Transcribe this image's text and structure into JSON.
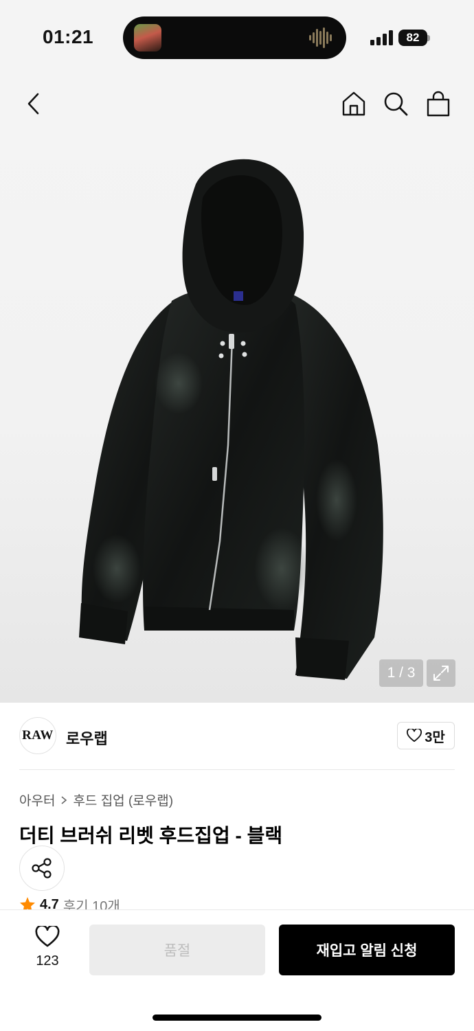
{
  "status_bar": {
    "time": "01:21",
    "battery": "82"
  },
  "header": {
    "back_icon": "chevron-left-icon",
    "home_icon": "home-icon",
    "search_icon": "search-icon",
    "cart_icon": "shopping-bag-icon"
  },
  "gallery": {
    "current": 1,
    "total": 3,
    "indicator": "1 / 3",
    "expand_icon": "expand-icon"
  },
  "brand": {
    "logo_text": "RAW",
    "name": "로우랩",
    "likes": "3만"
  },
  "breadcrumb": {
    "category": "아우터",
    "subcategory": "후드 집업 (로우랩)"
  },
  "product": {
    "title": "더티 브러쉬 리벳 후드집업 - 블랙"
  },
  "rating": {
    "score": "4.7",
    "reviews": "후기 10개"
  },
  "bottom_bar": {
    "wish_count": "123",
    "soldout_label": "품절",
    "restock_label": "재입고 알림 신청"
  },
  "colors": {
    "accent": "#000000",
    "star": "#ff8a00",
    "disabled_bg": "#ececec"
  }
}
